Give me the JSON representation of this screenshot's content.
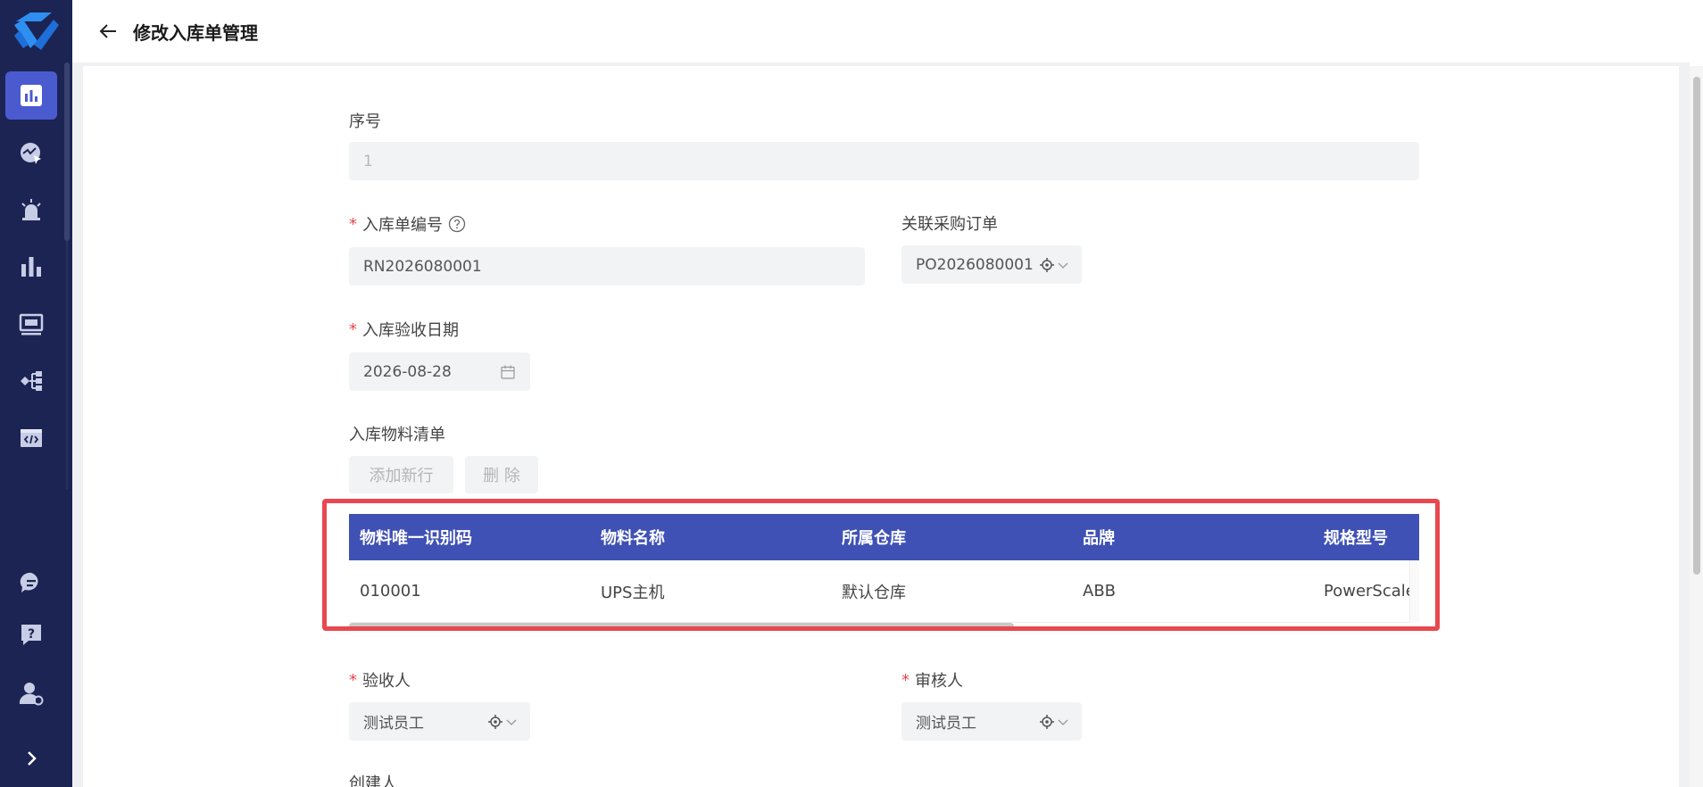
{
  "header": {
    "title": "修改入库单管理"
  },
  "sidebar": {
    "items": [
      {
        "icon": "dashboard-icon",
        "active": true
      },
      {
        "icon": "monitor-chart-icon",
        "active": false
      },
      {
        "icon": "alarm-icon",
        "active": false
      },
      {
        "icon": "bar-chart-icon",
        "active": false
      },
      {
        "icon": "screen-icon",
        "active": false
      },
      {
        "icon": "flow-icon",
        "active": false
      },
      {
        "icon": "code-icon",
        "active": false
      },
      {
        "icon": "chat-icon",
        "active": false
      },
      {
        "icon": "help-icon",
        "active": false
      },
      {
        "icon": "user-settings-icon",
        "active": false
      },
      {
        "icon": "expand-icon",
        "active": false
      }
    ]
  },
  "form": {
    "seq_label": "序号",
    "seq_value": "1",
    "receipt_no_label": "入库单编号",
    "receipt_no_value": "RN2026080001",
    "po_label": "关联采购订单",
    "po_value": "PO2026080001",
    "date_label": "入库验收日期",
    "date_value": "2026-08-28",
    "materials_label": "入库物料清单",
    "add_row_label": "添加新行",
    "delete_label": "删 除",
    "receiver_label": "验收人",
    "receiver_value": "测试员工",
    "reviewer_label": "审核人",
    "reviewer_value": "测试员工",
    "creator_label": "创建人"
  },
  "table": {
    "columns": [
      "物料唯一识别码",
      "物料名称",
      "所属仓库",
      "品牌",
      "规格型号"
    ],
    "rows": [
      [
        "010001",
        "UPS主机",
        "默认仓库",
        "ABB",
        "PowerScale"
      ]
    ]
  },
  "colors": {
    "sidebar_bg": "#1c2454",
    "accent": "#3f51b5",
    "highlight": "#e8484f",
    "required": "#e5484d"
  }
}
